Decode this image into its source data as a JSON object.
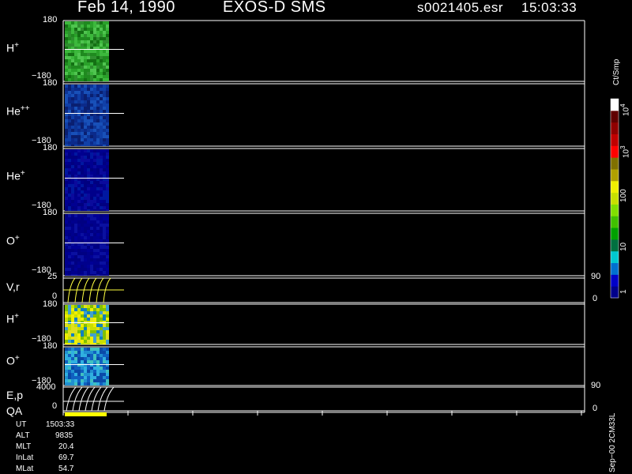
{
  "header": {
    "date": "Feb 14, 1990",
    "mission": "EXOS-D SMS",
    "file": "s0021405.esr",
    "time": "15:03:33"
  },
  "panels": [
    {
      "id": "h_plus",
      "label": "H",
      "sup": "+",
      "top": "180",
      "bottom": "−180"
    },
    {
      "id": "he_pp",
      "label": "He",
      "sup": "++",
      "top": "180",
      "bottom": "−180"
    },
    {
      "id": "he_plus",
      "label": "He",
      "sup": "+",
      "top": "180",
      "bottom": "−180"
    },
    {
      "id": "o_plus",
      "label": "O",
      "sup": "+",
      "top": "180",
      "bottom": "−180"
    },
    {
      "id": "vr",
      "label": "V,r",
      "sup": "",
      "top": "25",
      "bottom": "0",
      "right_top": "90",
      "right_bottom": "0"
    },
    {
      "id": "h_plus2",
      "label": "H",
      "sup": "+",
      "top": "180",
      "bottom": "−180"
    },
    {
      "id": "o_plus2",
      "label": "O",
      "sup": "+",
      "top": "180",
      "bottom": "−180"
    },
    {
      "id": "ep",
      "label": "E,p",
      "sup": "",
      "top": "4000",
      "bottom": "0",
      "right_top": "90",
      "right_bottom": "0"
    }
  ],
  "qa_label": "QA",
  "colorbar": {
    "unit": "Ct/Smp",
    "labels": {
      "t1": "1",
      "t10": "10",
      "t100": "100",
      "t1000": "10",
      "t1000_exp": "3",
      "t10000": "10",
      "t10000_exp": "4"
    },
    "colors": [
      "#00008b",
      "#0000c8",
      "#0070d0",
      "#00c8d0",
      "#007040",
      "#00a000",
      "#40c000",
      "#80e000",
      "#c8e000",
      "#f0f000",
      "#b0a000",
      "#807000",
      "#ff0000",
      "#c00000",
      "#900000",
      "#600000",
      "#ffffff"
    ]
  },
  "footer": {
    "rows": [
      {
        "name": "UT",
        "value": "1503:33"
      },
      {
        "name": "ALT",
        "value": "9835"
      },
      {
        "name": "MLT",
        "value": "20.4"
      },
      {
        "name": "InLat",
        "value": "69.7"
      },
      {
        "name": "MLat",
        "value": "54.7"
      }
    ],
    "version": "Sep−00 2CM33L"
  },
  "chart_data": {
    "type": "heatmap",
    "title": "Feb 14, 1990   EXOS-D SMS",
    "time_label": "15:03:33",
    "panels": [
      "H+",
      "He++",
      "He+",
      "O+",
      "V,r",
      "H+",
      "O+",
      "E,p",
      "QA"
    ],
    "angle_range": [
      -180,
      180
    ],
    "vr_range": [
      0,
      25
    ],
    "ep_range": [
      0,
      4000
    ],
    "colorbar_range": [
      1,
      10000
    ],
    "colorbar_scale": "log"
  }
}
